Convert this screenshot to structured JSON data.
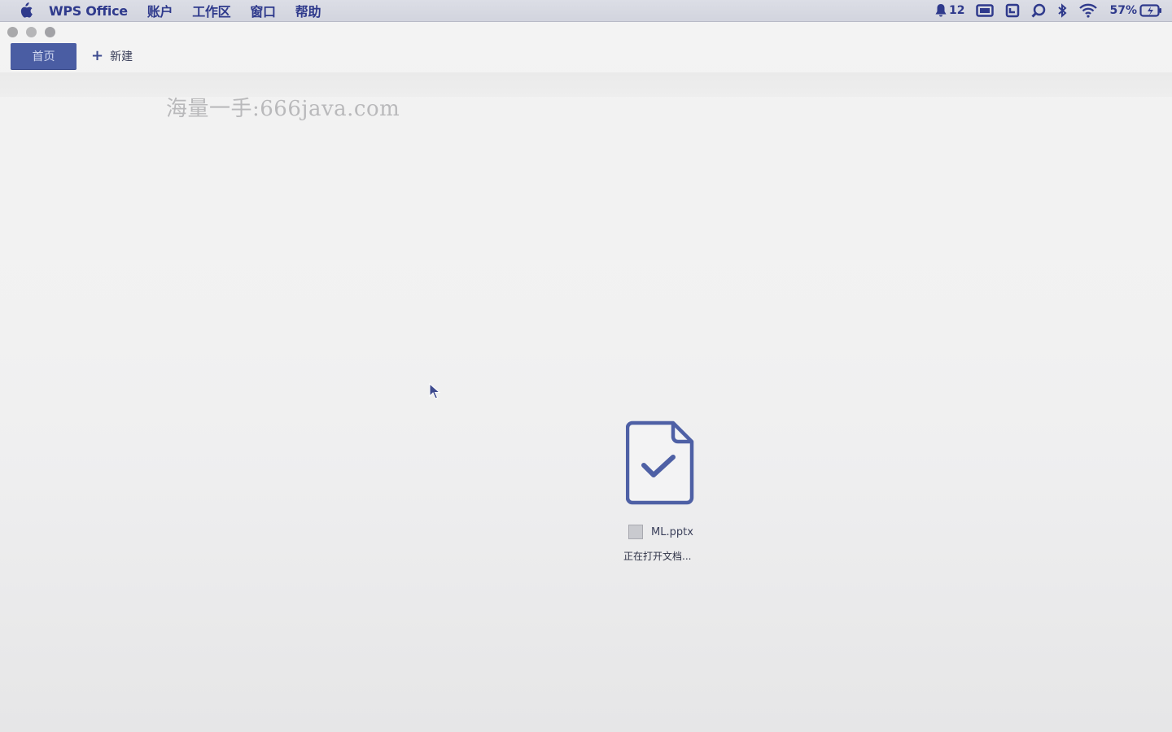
{
  "menubar": {
    "app_name": "WPS Office",
    "items": [
      "账户",
      "工作区",
      "窗口",
      "帮助"
    ],
    "status": {
      "notification_count": "12",
      "battery": "57%"
    }
  },
  "tabs": {
    "home_label": "首页",
    "new_label": "新建"
  },
  "watermark": "海量一手:666java.com",
  "loader": {
    "file_name": "ML.pptx",
    "status": "正在打开文档..."
  },
  "colors": {
    "accent": "#4a5da3",
    "menu_text": "#2f3a8c"
  }
}
